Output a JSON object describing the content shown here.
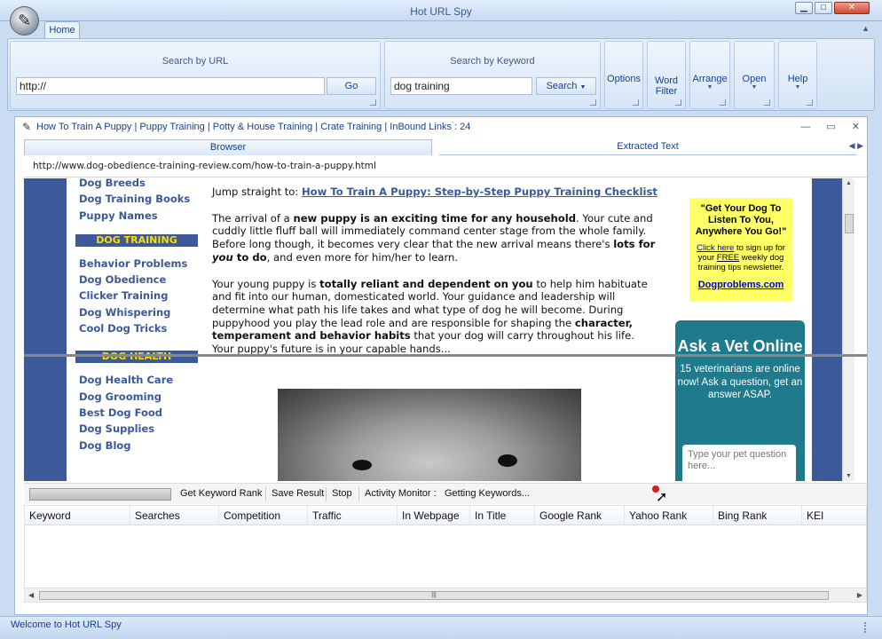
{
  "window": {
    "title": "Hot URL Spy",
    "minimize": "▁",
    "maximize": "□",
    "close": "✕"
  },
  "ribbon": {
    "home_tab": "Home",
    "search_url": {
      "label": "Search by URL",
      "value": "http://",
      "go": "Go"
    },
    "search_keyword": {
      "label": "Search by Keyword",
      "value": "dog training",
      "search": "Search"
    },
    "buttons": [
      {
        "label": "Options",
        "dropdown": false
      },
      {
        "label": "Word Filter",
        "dropdown": false
      },
      {
        "label": "Arrange",
        "dropdown": true
      },
      {
        "label": "Open",
        "dropdown": true
      },
      {
        "label": "Help",
        "dropdown": true
      }
    ]
  },
  "doc": {
    "title": "How To Train A Puppy | Puppy Training | Potty & House Training | Crate Training | InBound Links : 24",
    "tabs": {
      "browser": "Browser",
      "extracted": "Extracted Text"
    },
    "url": "http://www.dog-obedience-training-review.com/how-to-train-a-puppy.html"
  },
  "webpage": {
    "sidebar_top": [
      "Dog Breeds",
      "Dog Training Books",
      "Puppy Names"
    ],
    "heading_training": "DOG TRAINING",
    "sidebar_training": [
      "Behavior Problems",
      "Dog Obedience",
      "Clicker Training",
      "Dog Whispering",
      "Cool Dog Tricks"
    ],
    "heading_health": "DOG HEALTH",
    "sidebar_health": [
      "Dog Health Care",
      "Dog Grooming",
      "Best Dog Food",
      "Dog Supplies",
      "Dog Blog"
    ],
    "jump_prefix": "Jump straight to: ",
    "jump_link": "How To Train A Puppy: Step-by-Step Puppy Training Checklist",
    "p1": {
      "a": "The arrival of a ",
      "b": "new puppy is an exciting time for any household",
      "c": ". Your cute and cuddly little fluff ball will immediately command center stage from the whole family. Before long though, it becomes very clear that the new arrival means there's ",
      "d": "lots for ",
      "e": "you",
      "f": " to do",
      "g": ", and even more for him/her to learn."
    },
    "p2": {
      "a": "Your young puppy is ",
      "b": "totally reliant and dependent on you",
      "c": " to help him habituate and fit into our human, domesticated world. Your guidance and leadership will determine what path his life takes and what type of dog he will become. During puppyhood you play the lead role and are responsible for shaping the ",
      "d": "character, temperament and behavior habits",
      "e": " that your dog will carry throughout his life. Your puppy's future is in your capable hands..."
    },
    "ad": {
      "quote": "\"Get Your Dog To Listen To You, Anywhere You Go!\"",
      "click": "Click here",
      "sign1": " to sign up for your ",
      "free": "FREE",
      "sign2": " weekly dog training tips newsletter.",
      "link": "Dogproblems.com"
    },
    "vet": {
      "title": "Ask a Vet Online",
      "desc": "15 veterinarians are online now! Ask a question, get an answer ASAP.",
      "placeholder": "Type your pet question here..."
    }
  },
  "toolbar": {
    "get_rank": "Get Keyword Rank",
    "save": "Save Result",
    "stop": "Stop",
    "activity": "Activity Monitor :",
    "status": "Getting Keywords..."
  },
  "grid": {
    "columns": [
      "Keyword",
      "Searches",
      "Competition",
      "Traffic",
      "In Webpage",
      "In Title",
      "Google Rank",
      "Yahoo Rank",
      "Bing Rank",
      "KEI"
    ]
  },
  "statusbar": {
    "text": "Welcome to Hot URL Spy"
  }
}
